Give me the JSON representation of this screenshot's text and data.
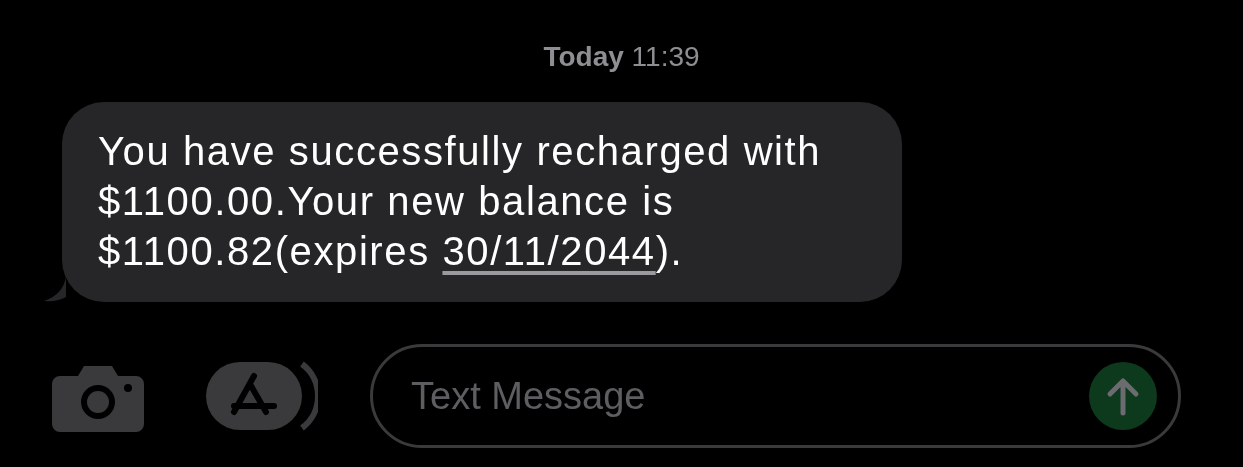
{
  "timestamp": {
    "day": "Today",
    "time": "11:39"
  },
  "messages": [
    {
      "kind": "received",
      "parts": [
        {
          "text": "You have successfully recharged with $1100.00.Your new balance is $1100.82(expires "
        },
        {
          "text": "30/11/2044",
          "link": true
        },
        {
          "text": ")."
        }
      ]
    }
  ],
  "composer": {
    "placeholder": "Text Message",
    "send_disabled": true
  }
}
